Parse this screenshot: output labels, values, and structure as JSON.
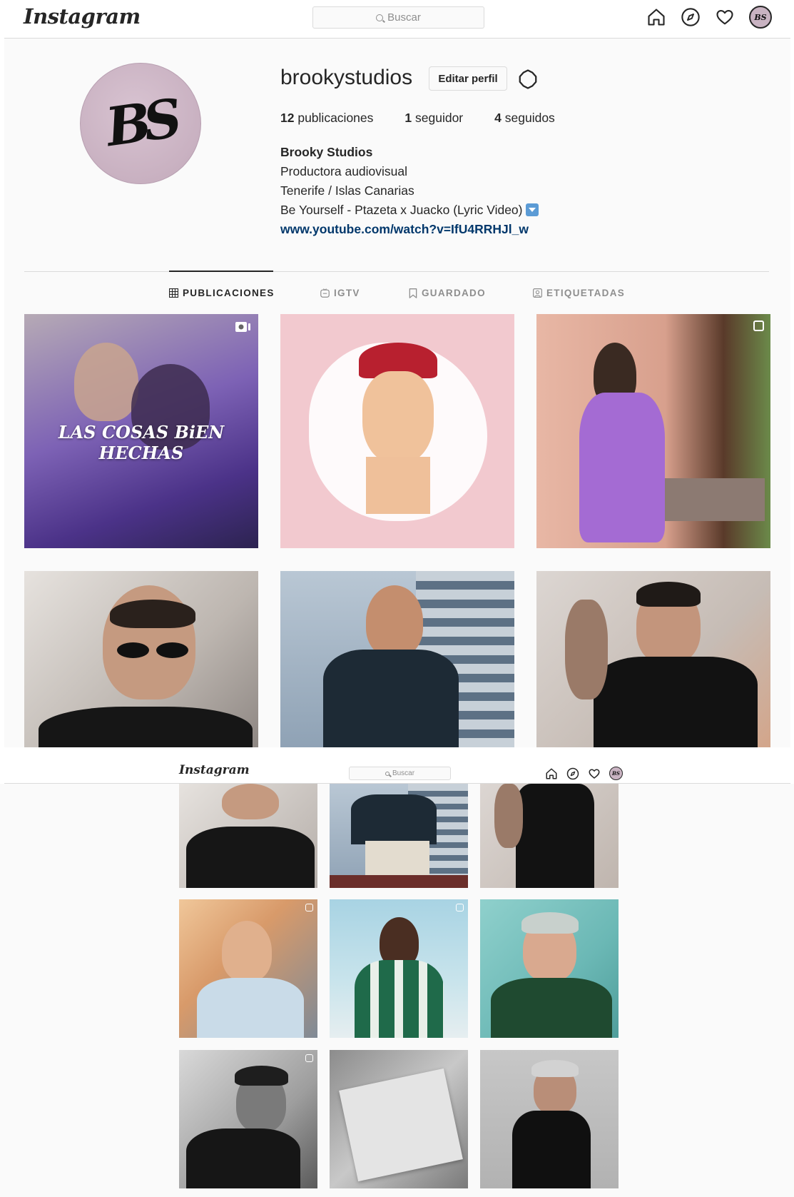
{
  "header": {
    "logo": "Instagram",
    "search_placeholder": "Buscar",
    "icons": [
      "home-icon",
      "explore-icon",
      "heart-icon",
      "profile-avatar"
    ],
    "avatar_initials": "BS"
  },
  "profile": {
    "avatar_initials": "BS",
    "username": "brookystudios",
    "edit_button": "Editar perfil",
    "settings_icon": "gear-icon",
    "stats": {
      "posts_count": "12",
      "posts_label": "publicaciones",
      "followers_count": "1",
      "followers_label": "seguidor",
      "following_count": "4",
      "following_label": "seguidos"
    },
    "bio": {
      "name": "Brooky Studios",
      "line1": "Productora audiovisual",
      "line2": "Tenerife / Islas Canarias",
      "line3": "Be Yourself - Ptazeta x Juacko (Lyric Video)",
      "link": "www.youtube.com/watch?v=IfU4RRHJl_w"
    }
  },
  "tabs": [
    {
      "label": "PUBLICACIONES",
      "icon": "grid-icon",
      "active": true
    },
    {
      "label": "IGTV",
      "icon": "igtv-icon",
      "active": false
    },
    {
      "label": "GUARDADO",
      "icon": "bookmark-icon",
      "active": false
    },
    {
      "label": "ETIQUETADAS",
      "icon": "tag-icon",
      "active": false
    }
  ],
  "posts_top": [
    {
      "overlay_text": "LAS COSAS BiEN HECHAS",
      "badge": "video-icon"
    },
    {
      "overlay_text": "",
      "badge": ""
    },
    {
      "overlay_text": "",
      "badge": "multiple-icon"
    },
    {
      "overlay_text": "",
      "badge": ""
    },
    {
      "overlay_text": "",
      "badge": ""
    },
    {
      "overlay_text": "",
      "badge": ""
    }
  ],
  "colors": {
    "link": "#00376b",
    "border": "#dbdbdb",
    "muted": "#8e8e8e",
    "text": "#262626",
    "background": "#fafafa"
  }
}
